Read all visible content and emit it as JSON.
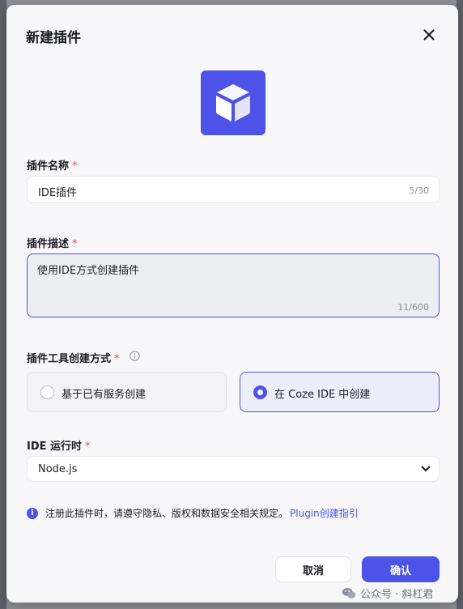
{
  "dialog": {
    "title": "新建插件"
  },
  "name_field": {
    "label": "插件名称",
    "required_mark": "*",
    "value": "IDE插件",
    "counter": "5/30"
  },
  "desc_field": {
    "label": "插件描述",
    "required_mark": "*",
    "value": "使用IDE方式创建插件",
    "counter": "11/600"
  },
  "method_field": {
    "label": "插件工具创建方式",
    "required_mark": "*",
    "options": [
      {
        "label": "基于已有服务创建",
        "selected": false
      },
      {
        "label": "在 Coze IDE 中创建",
        "selected": true
      }
    ]
  },
  "runtime_field": {
    "label": "IDE 运行时",
    "required_mark": "*",
    "value": "Node.js"
  },
  "notice": {
    "text": "注册此插件时，请遵守隐私、版权和数据安全相关规定。",
    "link": "Plugin创建指引"
  },
  "buttons": {
    "cancel": "取消",
    "confirm": "确认"
  },
  "watermark": {
    "text": "公众号 · 斜杠君"
  },
  "colors": {
    "accent": "#4d53e8",
    "required": "#f54a45"
  },
  "icons": {
    "close": "close-icon",
    "plugin": "cube-icon",
    "info": "info-icon",
    "select": "chevron-down-icon",
    "notice": "info-filled-icon",
    "watermark": "wechat-icon"
  }
}
